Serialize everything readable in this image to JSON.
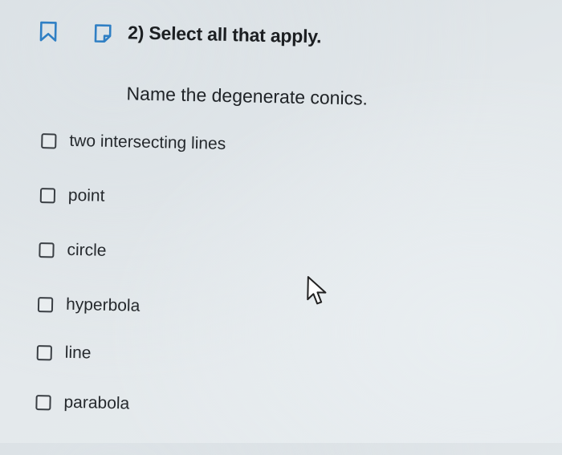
{
  "question": {
    "number_title": "2) Select all that apply.",
    "prompt": "Name the degenerate conics."
  },
  "options": [
    {
      "label": "two intersecting lines",
      "checked": false
    },
    {
      "label": "point",
      "checked": false
    },
    {
      "label": "circle",
      "checked": false
    },
    {
      "label": "hyperbola",
      "checked": false
    },
    {
      "label": "line",
      "checked": false
    },
    {
      "label": "parabola",
      "checked": false
    }
  ],
  "icons": {
    "bookmark": "bookmark-icon",
    "note": "note-icon",
    "cursor": "mouse-pointer-icon"
  },
  "colors": {
    "icon_accent": "#2f7fc4",
    "checkbox_border": "#3a3f44"
  }
}
